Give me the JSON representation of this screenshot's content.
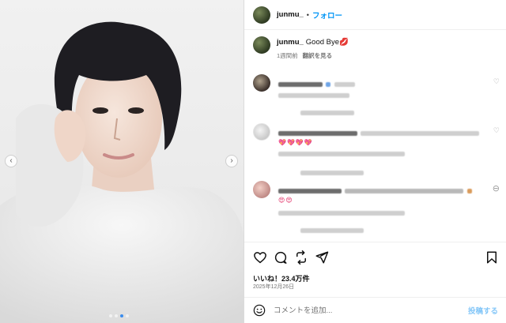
{
  "post": {
    "username": "junmu_",
    "bullet": "•",
    "follow_label": "フォロー",
    "caption_text": "Good Bye💋",
    "time_ago": "1週間前",
    "translate_label": "翻訳を見る",
    "likes_text": "いいね！23.4万件",
    "date_text": "2025年12月26日",
    "comment_placeholder": "コメントを追加...",
    "post_label": "投稿する"
  },
  "comments": [
    {
      "hearts": ""
    },
    {
      "hearts": "💖💖💖💖"
    },
    {
      "hearts": "😍😍"
    }
  ],
  "icons": {
    "prev": "chevron-left-icon",
    "next": "chevron-right-icon",
    "like": "heart-icon",
    "comment": "comment-icon",
    "share": "repost-icon",
    "send": "send-icon",
    "save": "bookmark-icon",
    "emoji": "emoji-icon"
  },
  "colors": {
    "accent": "#0095f6",
    "post_disabled": "#85c7f8",
    "carousel_active": "#3b8ced"
  }
}
